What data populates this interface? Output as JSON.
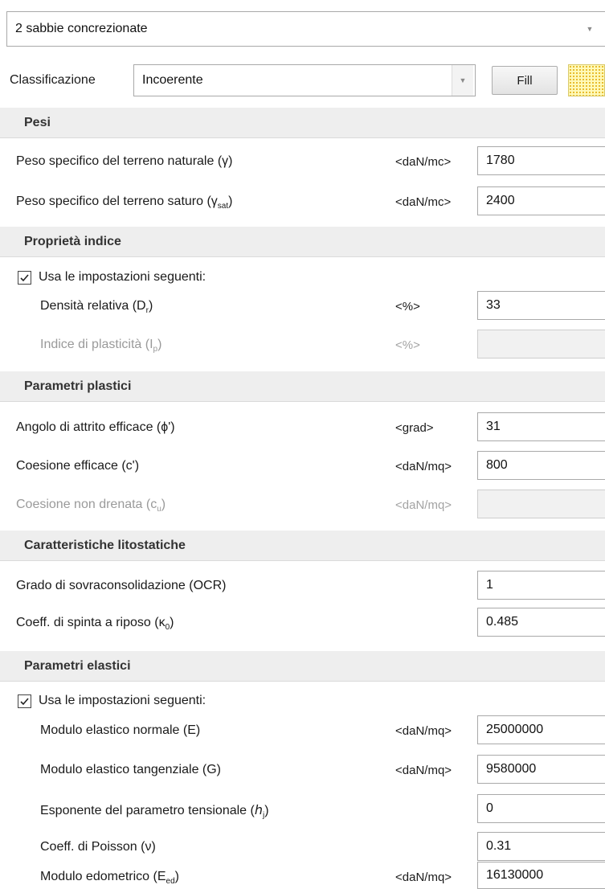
{
  "top_select": {
    "value": "2 sabbie concrezionate"
  },
  "classification": {
    "label": "Classificazione",
    "value": "Incoerente",
    "fill_button": "Fill",
    "swatch_color": "#fff9b8"
  },
  "sections": {
    "pesi": "Pesi",
    "proprieta_indice": "Proprietà indice",
    "parametri_plastici": "Parametri plastici",
    "caratteristiche_litostatiche": "Caratteristiche litostatiche",
    "parametri_elastici": "Parametri elastici"
  },
  "pesi": {
    "gamma": {
      "label": "Peso specifico del terreno naturale (",
      "sym": "γ",
      "close": ")",
      "unit": "<daN/mc>",
      "value": "1780"
    },
    "gamma_sat": {
      "label": "Peso specifico del terreno saturo (",
      "sym": "γ",
      "sub": "sat",
      "close": ")",
      "unit": "<daN/mc>",
      "value": "2400"
    }
  },
  "indice": {
    "use_label": "Usa le impostazioni seguenti:",
    "use_checked": true,
    "dr": {
      "label": "Densità relativa (D",
      "sub": "r",
      "close": ")",
      "unit": "<%>",
      "value": "33"
    },
    "ip": {
      "label": "Indice di plasticità (I",
      "sub": "p",
      "close": ")",
      "unit": "<%>",
      "value": ""
    }
  },
  "plastici": {
    "phi": {
      "label": "Angolo di attrito efficace (",
      "sym": "ϕ'",
      "close": ")",
      "unit": "<grad>",
      "value": "31"
    },
    "c": {
      "label": "Coesione efficace (c')",
      "unit": "<daN/mq>",
      "value": "800"
    },
    "cu": {
      "label": "Coesione non drenata (c",
      "sub": "u",
      "close": ")",
      "unit": "<daN/mq>",
      "value": ""
    }
  },
  "lito": {
    "ocr": {
      "label": "Grado di sovraconsolidazione (OCR)",
      "value": "1"
    },
    "k0": {
      "label": "Coeff. di spinta a riposo (",
      "sym": "κ",
      "sub": "0",
      "close": ")",
      "value": "0.485"
    }
  },
  "elastici": {
    "use_label": "Usa le impostazioni seguenti:",
    "use_checked": true,
    "E": {
      "label": "Modulo elastico normale (E)",
      "unit": "<daN/mq>",
      "value": "25000000"
    },
    "G": {
      "label": "Modulo elastico tangenziale (G)",
      "unit": "<daN/mq>",
      "value": "9580000"
    },
    "exp": {
      "label": "Esponente del parametro tensionale (",
      "sym": "ℎ",
      "sub": "j",
      "close": ")",
      "value": "0"
    },
    "nu": {
      "label": "Coeff. di Poisson (",
      "sym": "ν",
      "close": ")",
      "value": "0.31"
    },
    "eed": {
      "label": "Modulo edometrico (E",
      "sub": "ed",
      "close": ")",
      "unit": "<daN/mq>",
      "value": "16130000"
    }
  }
}
